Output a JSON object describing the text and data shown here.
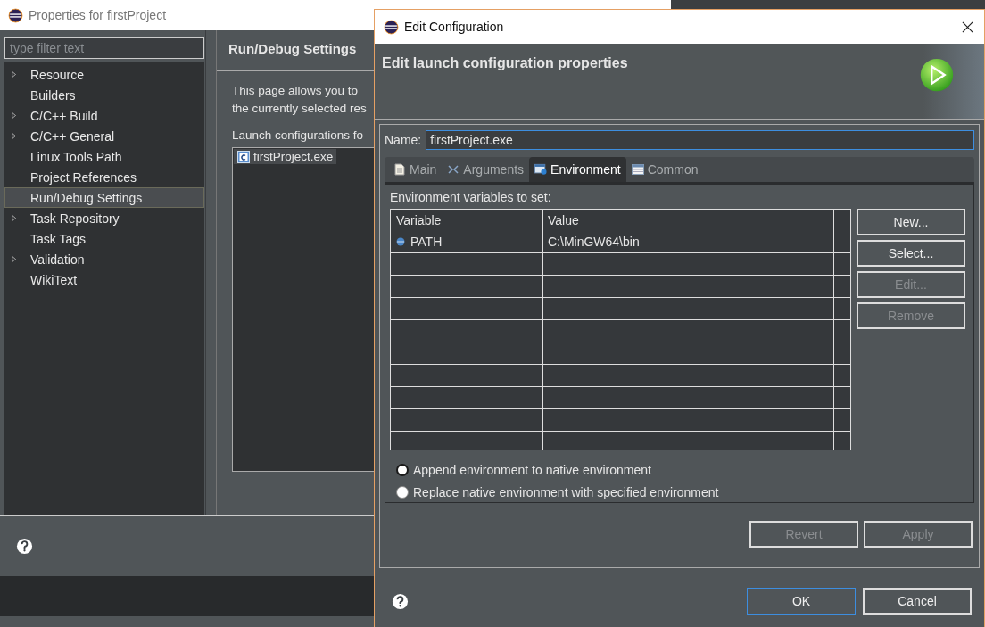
{
  "background_window": {
    "title": "Properties for firstProject",
    "filter": {
      "placeholder": "type filter text"
    },
    "tree": [
      {
        "label": "Resource",
        "expandable": true,
        "selected": false
      },
      {
        "label": "Builders",
        "expandable": false,
        "selected": false
      },
      {
        "label": "C/C++ Build",
        "expandable": true,
        "selected": false
      },
      {
        "label": "C/C++ General",
        "expandable": true,
        "selected": false
      },
      {
        "label": "Linux Tools Path",
        "expandable": false,
        "selected": false
      },
      {
        "label": "Project References",
        "expandable": false,
        "selected": false
      },
      {
        "label": "Run/Debug Settings",
        "expandable": false,
        "selected": true
      },
      {
        "label": "Task Repository",
        "expandable": true,
        "selected": false
      },
      {
        "label": "Task Tags",
        "expandable": false,
        "selected": false
      },
      {
        "label": "Validation",
        "expandable": true,
        "selected": false
      },
      {
        "label": "WikiText",
        "expandable": false,
        "selected": false
      }
    ],
    "page": {
      "title": "Run/Debug Settings",
      "description_lines": [
        "This page allows you to",
        "the currently selected res"
      ],
      "list_label": "Launch configurations fo",
      "configurations": [
        {
          "label": "firstProject.exe",
          "selected": true
        }
      ]
    }
  },
  "dialog": {
    "title": "Edit Configuration",
    "banner": "Edit launch configuration properties",
    "name_label": "Name:",
    "name_value": "firstProject.exe",
    "tabs": [
      {
        "label": "Main",
        "kind": "main",
        "selected": false
      },
      {
        "label": "Arguments",
        "kind": "arguments",
        "selected": false
      },
      {
        "label": "Environment",
        "kind": "environment",
        "selected": true
      },
      {
        "label": "Common",
        "kind": "common",
        "selected": false
      }
    ],
    "env_label": "Environment variables to set:",
    "table": {
      "columns": [
        "Variable",
        "Value"
      ],
      "rows": [
        {
          "variable": "PATH",
          "value": "C:\\MinGW64\\bin"
        }
      ]
    },
    "side_buttons": [
      {
        "label": "New...",
        "disabled": false
      },
      {
        "label": "Select...",
        "disabled": false
      },
      {
        "label": "Edit...",
        "disabled": true
      },
      {
        "label": "Remove",
        "disabled": true
      }
    ],
    "radios": [
      {
        "label": "Append environment to native environment",
        "selected": true
      },
      {
        "label": "Replace native environment with specified environment",
        "selected": false
      }
    ],
    "apply_buttons": [
      {
        "label": "Revert",
        "disabled": true
      },
      {
        "label": "Apply",
        "disabled": true
      }
    ],
    "footer_buttons": [
      {
        "label": "OK",
        "default": true
      },
      {
        "label": "Cancel",
        "default": false
      }
    ]
  }
}
